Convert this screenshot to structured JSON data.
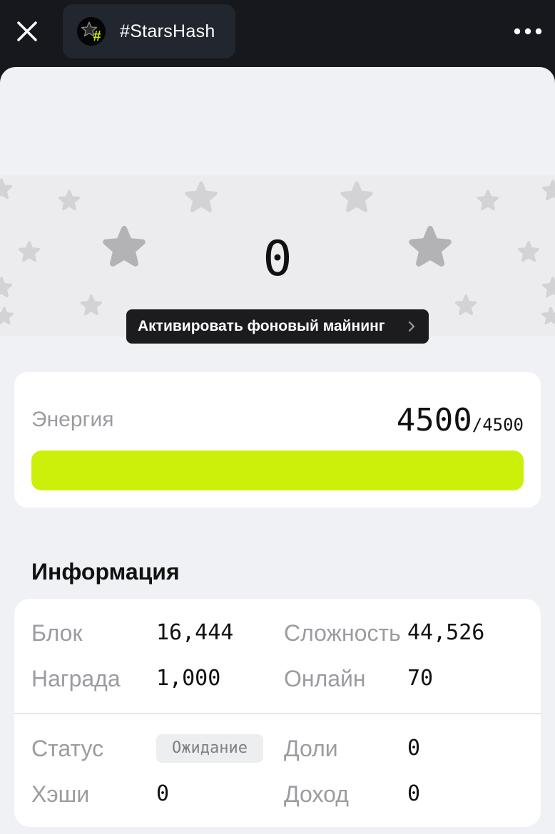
{
  "header": {
    "app_title": "#StarsHash",
    "logo_glyph": "#",
    "accent": "#cdf00a"
  },
  "hero": {
    "counter": "0",
    "activate_label": "Активировать фоновый майнинг"
  },
  "energy": {
    "label": "Энергия",
    "current": "4500",
    "max": "/4500",
    "fill_fraction": 1.0,
    "bar_color": "#cdf00a"
  },
  "info": {
    "title": "Информация",
    "block_label": "Блок",
    "block_value": "16,444",
    "difficulty_label": "Сложность",
    "difficulty_value": "44,526",
    "reward_label": "Награда",
    "reward_value": "1,000",
    "online_label": "Онлайн",
    "online_value": "70",
    "status_label": "Статус",
    "status_value": "Ожидание",
    "shares_label": "Доли",
    "shares_value": "0",
    "hashes_label": "Хэши",
    "hashes_value": "0",
    "income_label": "Доход",
    "income_value": "0"
  }
}
